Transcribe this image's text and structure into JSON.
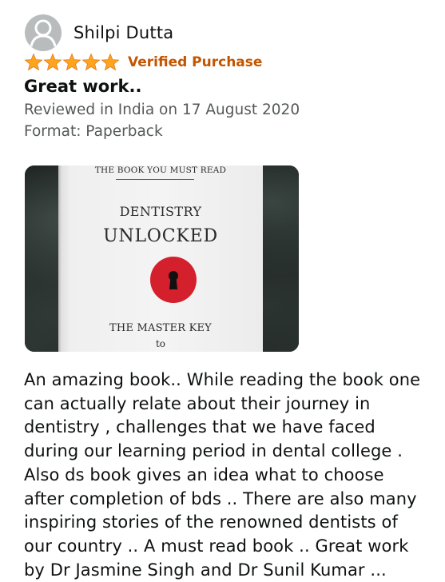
{
  "review": {
    "reviewer_name": "Shilpi Dutta",
    "avatar_icon": "user-icon",
    "rating": 5,
    "rating_max": 5,
    "star_color": "#ffa41c",
    "verified_label": "Verified Purchase",
    "verified_color": "#c45500",
    "title": "Great work..",
    "date_line": "Reviewed in India on 17 August 2020",
    "format_line": "Format: Paperback",
    "photo": {
      "tagline": "THE BOOK YOU MUST READ",
      "subject": "DENTISTRY",
      "title": "UNLOCKED",
      "keyhole_icon": "keyhole-icon",
      "bottom_line1": "THE MASTER KEY",
      "bottom_line2": "to"
    },
    "body": "An amazing book.. While reading the book one can actually relate about their journey in dentistry , challenges that we have faced during our learning period in dental college . Also ds book gives an idea what to choose after completion of bds .. There are also many inspiring stories of the renowned dentists of our country .. A must read book .. Great work by Dr Jasmine Singh and Dr Sunil Kumar ..."
  }
}
